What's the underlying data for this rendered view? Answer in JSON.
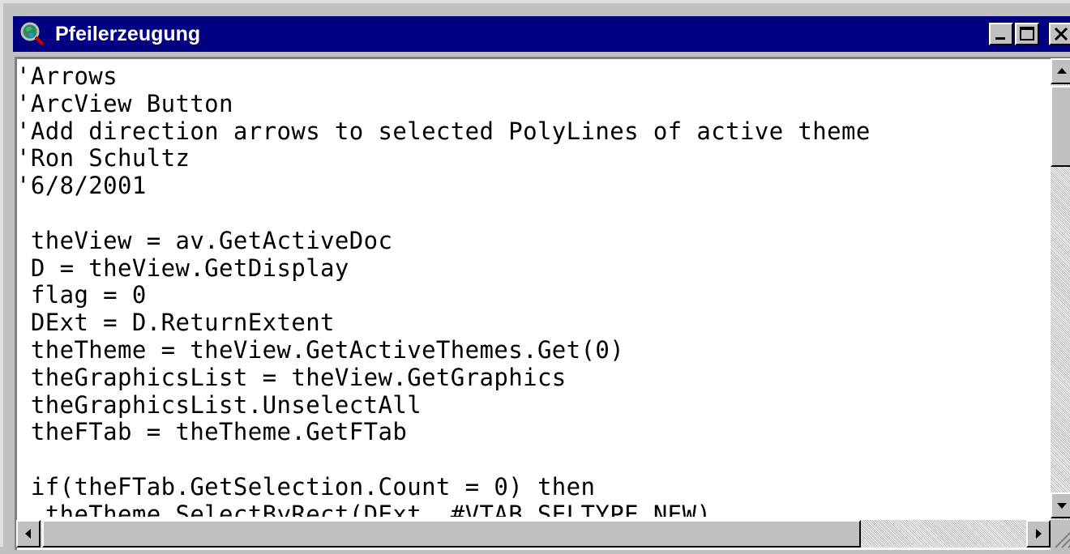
{
  "window": {
    "title": "Pfeilerzeugung",
    "icon": "arcview-globe-magnifier-icon",
    "controls": [
      "minimize-icon",
      "maximize-icon",
      "close-icon"
    ]
  },
  "editor": {
    "lines": [
      "'Arrows",
      "'ArcView Button",
      "'Add direction arrows to selected PolyLines of active theme",
      "'Ron Schultz",
      "'6/8/2001",
      "",
      " theView = av.GetActiveDoc",
      " D = theView.GetDisplay",
      " flag = 0",
      " DExt = D.ReturnExtent",
      " theTheme = theView.GetActiveThemes.Get(0)",
      " theGraphicsList = theView.GetGraphics",
      " theGraphicsList.UnselectAll",
      " theFTab = theTheme.GetFTab",
      "",
      " if(theFTab.GetSelection.Count = 0) then",
      "  theTheme.SelectByRect(DExt, #VTAB_SELTYPE_NEW)"
    ]
  },
  "colors": {
    "title_bar": "#000080",
    "window_face": "#c0c0c0",
    "editor_background": "#ffffff",
    "text": "#000000"
  }
}
